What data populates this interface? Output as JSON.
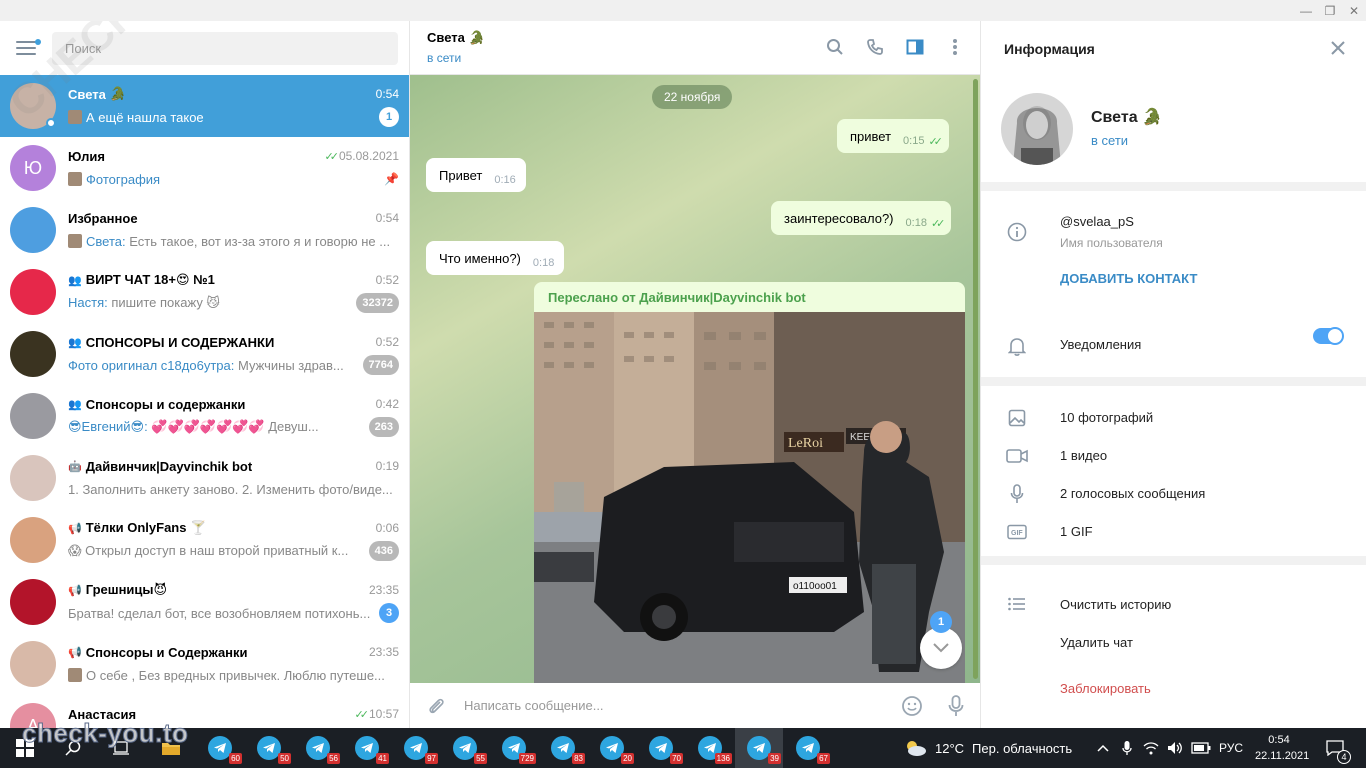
{
  "window": {
    "minimize": "—",
    "maximize": "❐",
    "close": "✕"
  },
  "sidebar": {
    "search_placeholder": "Поиск",
    "chats": [
      {
        "name": "Света",
        "emoji": "🐊",
        "time": "0:54",
        "preview": "А ещё нашла такое",
        "sender": "",
        "badge": "1",
        "active": true,
        "avatar_color": "#c7b2a6",
        "avatar_letter": "",
        "online": true,
        "thumb": true
      },
      {
        "name": "Юлия",
        "emoji": "",
        "time": "05.08.2021",
        "preview": "Фотография",
        "sender": "",
        "badge": "",
        "active": false,
        "avatar_color": "#b481db",
        "avatar_letter": "Ю",
        "read": true,
        "pinned": true,
        "thumb": true,
        "preview_link": true
      },
      {
        "name": "Избранное",
        "emoji": "",
        "time": "0:54",
        "preview": "Есть такое, вот из-за этого я и говорю не ...",
        "sender": "Света:",
        "badge": "",
        "active": false,
        "avatar_color": "#4e9ee0",
        "avatar_letter": "",
        "thumb": true
      },
      {
        "name": "ВИРТ ЧАТ 18+😍 №1",
        "emoji": "",
        "time": "0:52",
        "preview": "пишите покажу 😼",
        "sender": "Настя:",
        "badge": "32372",
        "active": false,
        "avatar_color": "#e6284a",
        "avatar_letter": "",
        "group": true
      },
      {
        "name": "СПОНСОРЫ И СОДЕРЖАНКИ",
        "emoji": "",
        "time": "0:52",
        "preview": "Мужчины здрав...",
        "sender": "Фото оригинал с18до6утра:",
        "badge": "7764",
        "active": false,
        "avatar_color": "#3a3320",
        "avatar_letter": "",
        "group": true
      },
      {
        "name": "Спонсоры и содержанки",
        "emoji": "",
        "time": "0:42",
        "preview": "💞💞💞💞💞💞💞 Девуш...",
        "sender": "😎Евгений😎:",
        "badge": "263",
        "active": false,
        "avatar_color": "#9a9aa0",
        "avatar_letter": "",
        "group": true
      },
      {
        "name": "Дайвинчик|Dayvinchik bot",
        "emoji": "",
        "time": "0:19",
        "preview": "1. Заполнить анкету заново. 2. Изменить фото/виде...",
        "sender": "",
        "badge": "",
        "active": false,
        "avatar_color": "#d9c5bd",
        "avatar_letter": "",
        "bot": true
      },
      {
        "name": "Тёлки OnlyFans 🍸",
        "emoji": "",
        "time": "0:06",
        "preview": "😱 Открыл доступ в наш второй приватный к...",
        "sender": "",
        "badge": "436",
        "active": false,
        "avatar_color": "#d9a27f",
        "avatar_letter": "",
        "channel": true
      },
      {
        "name": "Грешницы😈",
        "emoji": "",
        "time": "23:35",
        "preview": "Братва! сделал бот, все возобновляем потихонь...",
        "sender": "",
        "badge": "3",
        "badge_blue": true,
        "active": false,
        "avatar_color": "#b3142a",
        "avatar_letter": "",
        "channel": true
      },
      {
        "name": "Спонсоры и Содержанки",
        "emoji": "",
        "time": "23:35",
        "preview": "О себе ,  Без вредных привычек.  Люблю путеше...",
        "sender": "",
        "badge": "",
        "active": false,
        "avatar_color": "#d8b9a8",
        "avatar_letter": "",
        "channel": true,
        "thumb": true
      },
      {
        "name": "Анастасия",
        "emoji": "",
        "time": "10:57",
        "preview": "",
        "sender": "",
        "badge": "",
        "active": false,
        "avatar_color": "#e58fa0",
        "avatar_letter": "А",
        "read": true
      }
    ]
  },
  "conversation": {
    "name": "Света",
    "emoji": "🐊",
    "status": "в сети",
    "date_pill": "22 ноября",
    "messages": [
      {
        "text": "привет",
        "time": "0:15",
        "dir": "out"
      },
      {
        "text": "Привет",
        "time": "0:16",
        "dir": "in"
      },
      {
        "text": "заинтересовало?)",
        "time": "0:18",
        "dir": "out"
      },
      {
        "text": "Что именно?)",
        "time": "0:18",
        "dir": "in"
      }
    ],
    "forwarded_label": "Переслано от Дайвинчик|Dayvinchik bot",
    "photo": {
      "store_sign": "LeRoi",
      "sign2": "KEEPLOV",
      "plate": "о110оо01"
    },
    "scroll_badge": "1",
    "composer_placeholder": "Написать сообщение..."
  },
  "info": {
    "title": "Информация",
    "name": "Света",
    "emoji": "🐊",
    "status": "в сети",
    "username": "@svelaa_pS",
    "username_label": "Имя пользователя",
    "add_contact": "ДОБАВИТЬ КОНТАКТ",
    "notifications": "Уведомления",
    "notifications_on": true,
    "media": [
      "10 фотографий",
      "1 видео",
      "2 голосовых сообщения",
      "1 GIF"
    ],
    "gif_icon_label": "GIF",
    "clear_history": "Очистить историю",
    "delete_chat": "Удалить чат",
    "block": "Заблокировать"
  },
  "taskbar": {
    "tg_badges": [
      "60",
      "50",
      "56",
      "41",
      "97",
      "55",
      "729",
      "83",
      "20",
      "70",
      "136",
      "39",
      "67"
    ],
    "active_index": 11,
    "temperature": "12°C",
    "weather": "Пер. облачность",
    "lang": "РУС",
    "time": "0:54",
    "date": "22.11.2021",
    "notif_count": "4"
  },
  "watermark": {
    "text": "check-you.to",
    "diagonal": "CHECK-YOU.ME"
  },
  "colors": {
    "accent": "#419fd9",
    "link": "#3a8bc6",
    "forward": "#4ca14d",
    "danger": "#d14e4e"
  }
}
